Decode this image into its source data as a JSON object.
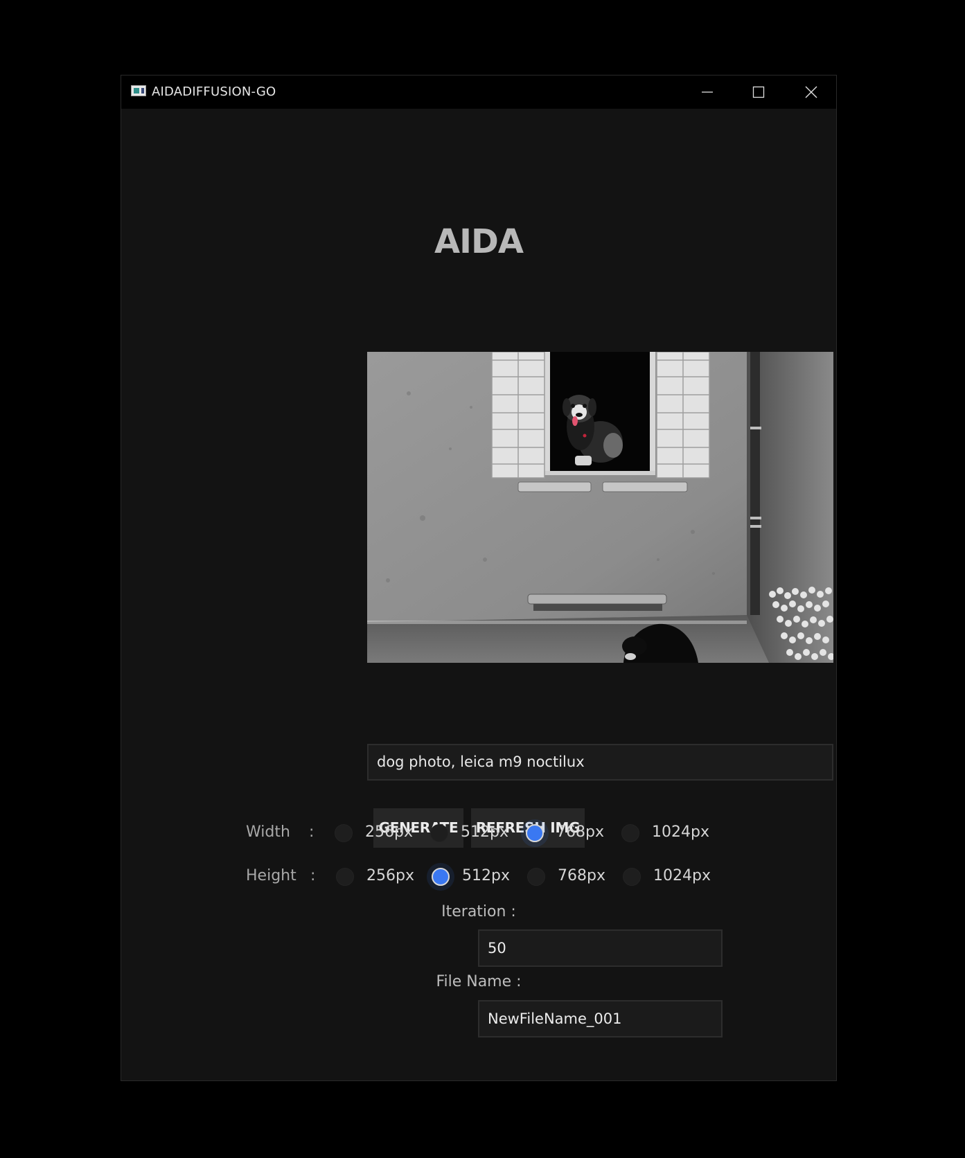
{
  "window": {
    "title": "AIDADIFFUSION-GO"
  },
  "header": {
    "title": "AIDA"
  },
  "prompt": {
    "value": "dog photo, leica m9 noctilux"
  },
  "actions": {
    "generate_label": "GENERATE",
    "refresh_label": "REFRESH IMG"
  },
  "width": {
    "label": "Width",
    "separator": ":",
    "options": [
      "256px",
      "512px",
      "768px",
      "1024px"
    ],
    "selected": "768px"
  },
  "height": {
    "label": "Height",
    "separator": ":",
    "options": [
      "256px",
      "512px",
      "768px",
      "1024px"
    ],
    "selected": "512px"
  },
  "iteration": {
    "label": "Iteration :",
    "value": "50"
  },
  "file_name": {
    "label": "File Name :",
    "value": "NewFileName_001"
  },
  "colors": {
    "window_bg": "#131313",
    "titlebar_bg": "#000000",
    "accent": "#3a78f2",
    "button_bg": "#262626"
  },
  "icons": [
    "app-icon",
    "minimize-icon",
    "maximize-icon",
    "close-icon"
  ]
}
